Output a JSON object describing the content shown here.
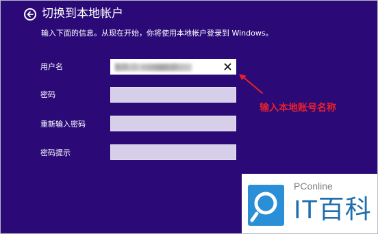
{
  "header": {
    "title": "切换到本地帐户",
    "back_icon": "back-arrow-icon"
  },
  "instruction": "输入下面的信息。从现在开始，你将使用本地帐户登录到 Windows。",
  "form": {
    "fields": [
      {
        "label": "用户名",
        "value": "果果 盘  xxxxxx 游",
        "active": true
      },
      {
        "label": "密码",
        "value": ""
      },
      {
        "label": "重新输入密码",
        "value": ""
      },
      {
        "label": "密码提示",
        "value": ""
      }
    ],
    "clear_icon": "close-icon"
  },
  "annotation": {
    "text": "输入本地账号名称",
    "color": "#e8202c"
  },
  "watermark": {
    "sub": "PConline",
    "main": "IT百科"
  },
  "colors": {
    "background": "#2b0a78",
    "field_inactive": "#d7cfe9",
    "field_active": "#ffffff",
    "text": "#ffffff",
    "logo_blue": "#2b8fd8"
  }
}
